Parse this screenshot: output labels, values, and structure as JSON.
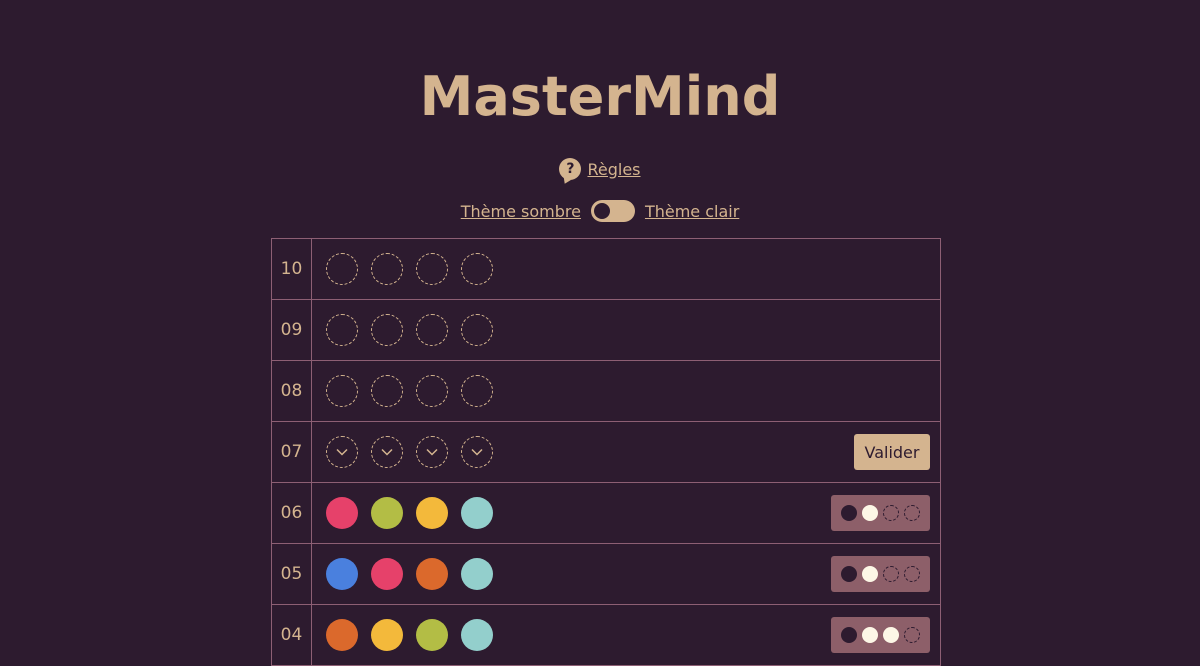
{
  "title": "MasterMind",
  "rules": {
    "icon": "question-bubble-icon",
    "label": "Règles"
  },
  "theme": {
    "dark_label": "Thème sombre",
    "light_label": "Thème clair",
    "state": "dark"
  },
  "colors": {
    "background": "#2d1b2f",
    "accent": "#d4b48f",
    "border": "#8d5f74",
    "pink": "#e6416a",
    "olive": "#b3bd45",
    "yellow": "#f3b93b",
    "teal": "#93cfcc",
    "blue": "#4a80de",
    "orange": "#db692c"
  },
  "validate_label": "Valider",
  "rows": [
    {
      "num": "10",
      "state": "empty"
    },
    {
      "num": "09",
      "state": "empty"
    },
    {
      "num": "08",
      "state": "empty"
    },
    {
      "num": "07",
      "state": "active"
    },
    {
      "num": "06",
      "state": "played",
      "pegs": [
        "#e6416a",
        "#b3bd45",
        "#f3b93b",
        "#93cfcc"
      ],
      "feedback": [
        "black",
        "white",
        "none",
        "none"
      ]
    },
    {
      "num": "05",
      "state": "played",
      "pegs": [
        "#4a80de",
        "#e6416a",
        "#db692c",
        "#93cfcc"
      ],
      "feedback": [
        "black",
        "white",
        "none",
        "none"
      ]
    },
    {
      "num": "04",
      "state": "played",
      "pegs": [
        "#db692c",
        "#f3b93b",
        "#b3bd45",
        "#93cfcc"
      ],
      "feedback": [
        "black",
        "white",
        "white",
        "none"
      ]
    }
  ]
}
